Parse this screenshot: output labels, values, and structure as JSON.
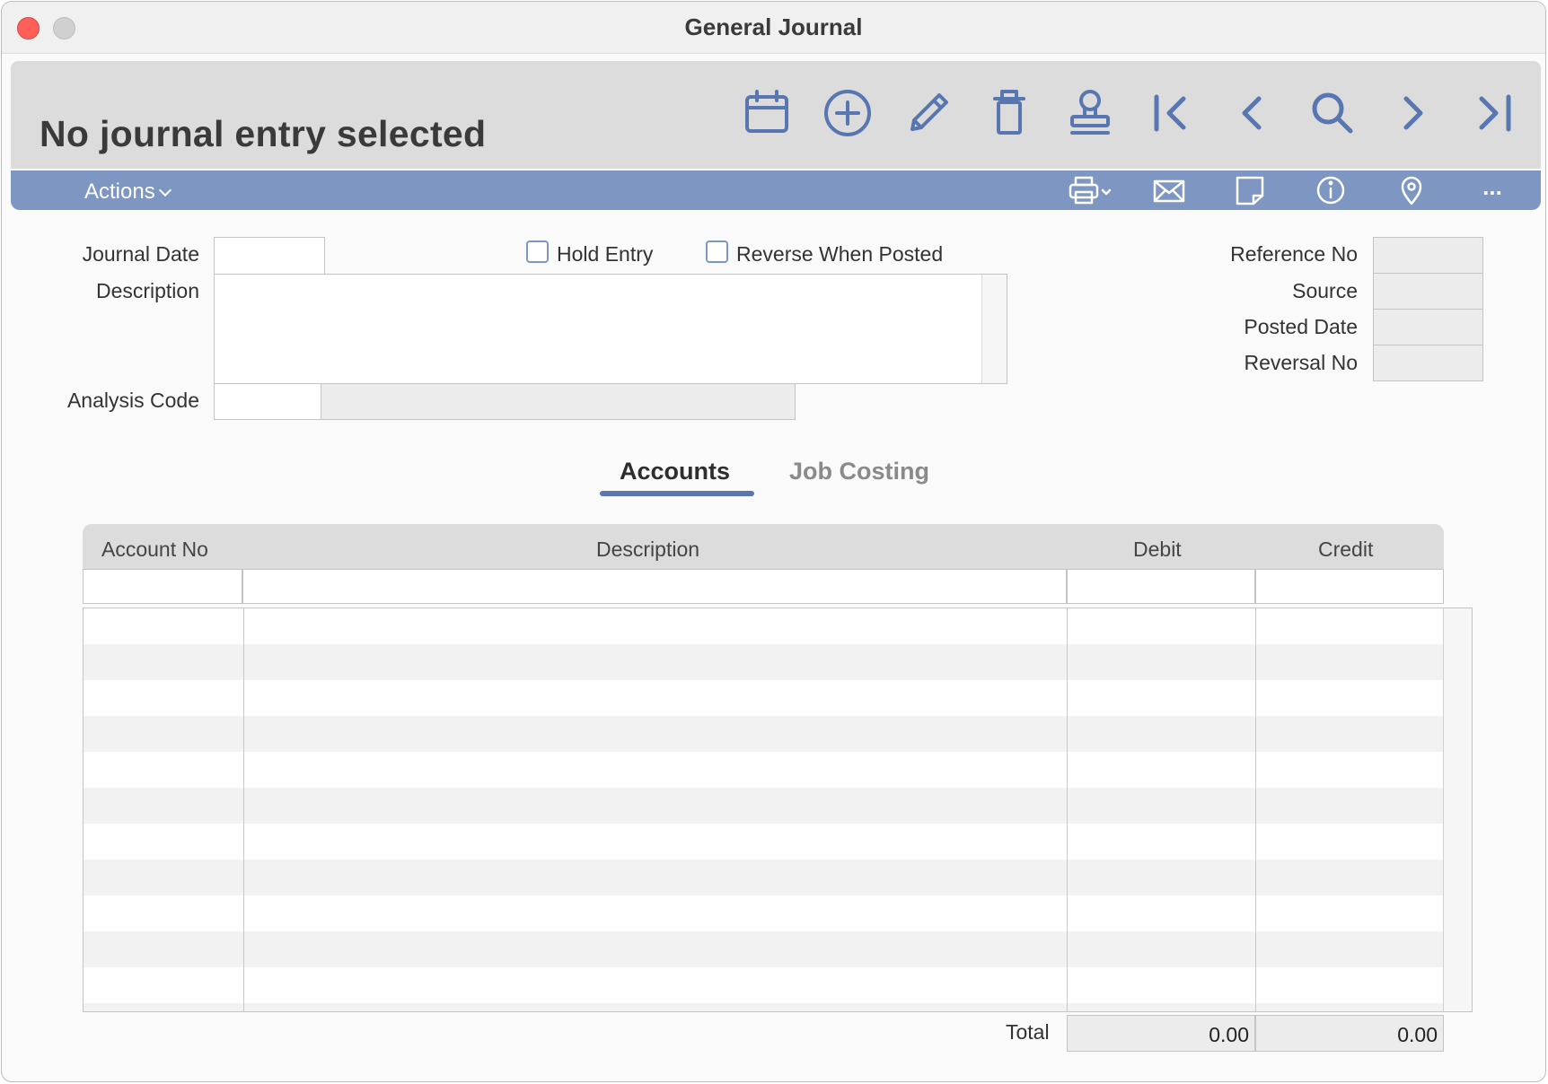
{
  "window": {
    "title": "General Journal"
  },
  "header": {
    "record_title": "No journal entry selected",
    "toolbar_icons": [
      "calendar-icon",
      "add-circle-icon",
      "pencil-icon",
      "trash-icon",
      "stamp-icon",
      "first-record-icon",
      "previous-record-icon",
      "search-icon",
      "next-record-icon",
      "last-record-icon"
    ]
  },
  "actionbar": {
    "actions_label": "Actions",
    "icons": [
      "printer-icon",
      "envelope-icon",
      "note-icon",
      "info-icon",
      "location-pin-icon",
      "more-icon"
    ],
    "more_label": "..."
  },
  "form": {
    "journal_date_label": "Journal Date",
    "journal_date_value": "",
    "description_label": "Description",
    "description_value": "",
    "analysis_code_label": "Analysis Code",
    "analysis_code_value": "",
    "analysis_desc_value": "",
    "hold_entry_label": "Hold Entry",
    "hold_entry_checked": false,
    "reverse_when_posted_label": "Reverse When Posted",
    "reverse_when_posted_checked": false,
    "reference_no_label": "Reference No",
    "source_label": "Source",
    "posted_date_label": "Posted Date",
    "reversal_no_label": "Reversal No"
  },
  "tabs": [
    {
      "label": "Accounts",
      "active": true
    },
    {
      "label": "Job Costing",
      "active": false
    }
  ],
  "grid": {
    "columns": [
      "Account No",
      "Description",
      "Debit",
      "Credit"
    ],
    "rows": []
  },
  "totals": {
    "label": "Total",
    "debit": "0.00",
    "credit": "0.00"
  },
  "colors": {
    "accent": "#7d96c2",
    "tab_underline": "#5876b0",
    "icon": "#5876b0",
    "close_button": "#fe5f57"
  }
}
